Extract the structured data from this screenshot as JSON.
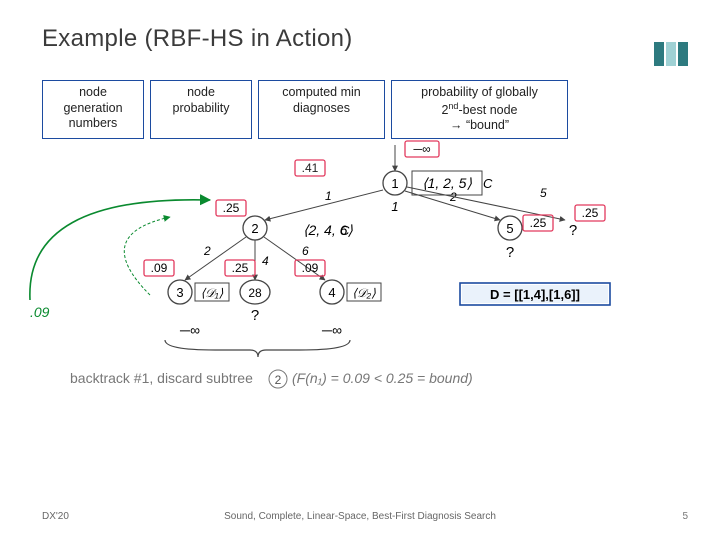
{
  "title": "Example (RBF-HS in Action)",
  "legend": {
    "gen": "node\ngeneration\nnumbers",
    "prob": "node\nprobability",
    "min": "computed min\ndiagnoses",
    "bound_l1": "probability of globally",
    "bound_l2a": "2",
    "bound_l2b": "nd",
    "bound_l2c": "-best node",
    "bound_l3": "→ “bound”"
  },
  "footer": {
    "left": "DX'20",
    "mid": "Sound, Complete, Linear-Space, Best-First Diagnosis Search",
    "page": "5"
  },
  "tree": {
    "root": {
      "id": "1",
      "assoc": "⟨1, 2, 5⟩",
      "below": "1",
      "inbound": "─∞"
    },
    "root_children": {
      "n2": {
        "id": "2",
        "edge": "1",
        "prob": ".41",
        "assoc": "⟨2, 4, 6⟩"
      },
      "n5": {
        "id": "5",
        "edge": "2",
        "prob": ".25"
      },
      "n7": {
        "edge": "5",
        "prob": ".25",
        "tip": "?"
      }
    },
    "n2_children": {
      "n3": {
        "id": "3",
        "edge": "2",
        "prob": ".09",
        "D": "⟨𝒟₁⟩"
      },
      "n28": {
        "id": "28",
        "edge": "4",
        "prob": ".25"
      },
      "n4": {
        "id": "4",
        "edge": "6",
        "prob": ".09",
        "D": "⟨𝒟₂⟩"
      }
    },
    "leaves": {
      "n3": "─∞",
      "n4": "─∞"
    },
    "result": "D = [[1,4],[1,6]]",
    "left_bubble": ".09",
    "backtrack_label": "backtrack #1, discard subtree",
    "backtrack_circ": "2",
    "backtrack_expr": "(F(n₁) = 0.09 < 0.25 = bound)"
  }
}
